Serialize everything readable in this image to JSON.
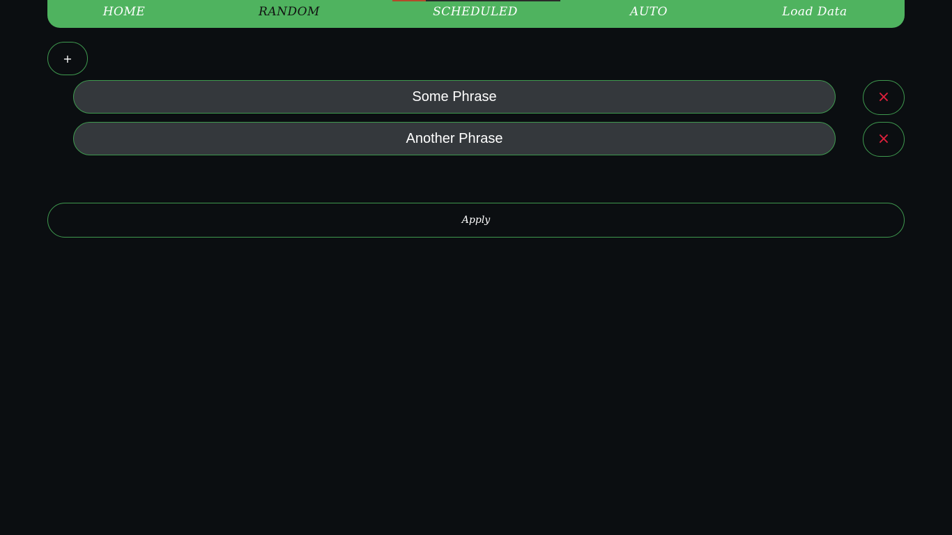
{
  "nav": {
    "items": [
      {
        "label": "HOME",
        "active": false
      },
      {
        "label": "RANDOM",
        "active": true
      },
      {
        "label": "SCHEDULED",
        "active": false
      },
      {
        "label": "AUTO",
        "active": false
      },
      {
        "label": "Load Data",
        "active": false
      }
    ]
  },
  "add_button": {
    "label": "+"
  },
  "phrases": [
    {
      "value": "Some Phrase",
      "remove_icon": "×"
    },
    {
      "value": "Another Phrase",
      "remove_icon": "×"
    }
  ],
  "apply_button": {
    "label": "Apply"
  },
  "colors": {
    "background": "#0b0e11",
    "navbar": "#4fb35f",
    "border_accent": "#3f9a4f",
    "input_bg": "#34383c",
    "remove_red": "#e0203c"
  }
}
